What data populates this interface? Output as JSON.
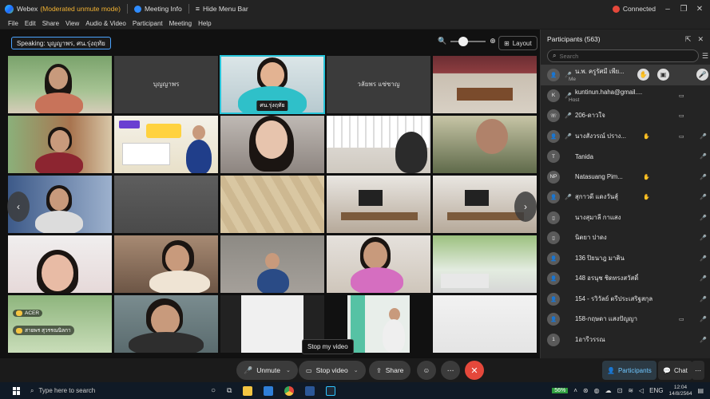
{
  "titlebar": {
    "app_name": "Webex",
    "mode": "(Moderated unmute mode)",
    "meeting_info": "Meeting Info",
    "hide_menu": "Hide Menu Bar",
    "connection": "Connected"
  },
  "menu": [
    "File",
    "Edit",
    "Share",
    "View",
    "Audio & Video",
    "Participant",
    "Meeting",
    "Help"
  ],
  "stage": {
    "speaking": "Speaking: บุญญาพร, ศน.รุ่งฤทัย",
    "layout_label": "Layout",
    "zoom_level": 0.35,
    "tiles": [
      {
        "name": ""
      },
      {
        "name": "บุญญาพร"
      },
      {
        "name": "ศน.รุ่งฤทัย"
      },
      {
        "name": "วลัยพร แซ่ซาญ"
      },
      {
        "name": ""
      },
      {
        "name": ""
      },
      {
        "name": ""
      },
      {
        "name": ""
      },
      {
        "name": ""
      },
      {
        "name": ""
      },
      {
        "name": ""
      },
      {
        "name": ""
      },
      {
        "name": ""
      },
      {
        "name": ""
      },
      {
        "name": ""
      },
      {
        "name": ""
      },
      {
        "name": ""
      },
      {
        "name": ""
      },
      {
        "name": ""
      },
      {
        "name": ""
      },
      {
        "name": ""
      },
      {
        "name": ""
      },
      {
        "name": ""
      },
      {
        "name": ""
      },
      {
        "name": ""
      }
    ],
    "overlay_labels": [
      "ACER",
      "สายพร สุวรรณนิลกา"
    ],
    "tooltip": "Stop my video"
  },
  "controls": {
    "unmute": "Unmute",
    "stop_video": "Stop video",
    "share": "Share",
    "participants_tab": "Participants",
    "chat_tab": "Chat"
  },
  "panel": {
    "title": "Participants (563)",
    "search_placeholder": "Search",
    "rows": [
      {
        "initials": "",
        "name": "น.พ. ครูรัศมี เพีย...",
        "sub": "Me"
      },
      {
        "initials": "K",
        "name": "kuntinun.haha@gmail....",
        "sub": "Host"
      },
      {
        "initials": "",
        "name": "206-ดาวใจ",
        "sub": ""
      },
      {
        "initials": "",
        "name": "นางสังวรณ์ ปราง...",
        "sub": ""
      },
      {
        "initials": "T",
        "name": "Tanida",
        "sub": ""
      },
      {
        "initials": "NP",
        "name": "Natasuang Pim...",
        "sub": ""
      },
      {
        "initials": "",
        "name": "สุกาวดี แดงวันสุ์",
        "sub": ""
      },
      {
        "initials": "",
        "name": "นางสุมาลี กาแสง",
        "sub": ""
      },
      {
        "initials": "",
        "name": "นิตยา ปาดง",
        "sub": ""
      },
      {
        "initials": "",
        "name": "136 ปิยนาฎ มาคิน",
        "sub": ""
      },
      {
        "initials": "",
        "name": "148 อรนุช ชิดทรงสวัสดิ์",
        "sub": ""
      },
      {
        "initials": "",
        "name": "154 - รวิวัลย์ ตรีประเสริฐสกุล",
        "sub": ""
      },
      {
        "initials": "",
        "name": "158-กฤษดา แสงปัญญา",
        "sub": ""
      },
      {
        "initials": "1",
        "name": "1อารีวรรณ",
        "sub": ""
      }
    ]
  },
  "taskbar": {
    "search_placeholder": "Type here to search",
    "battery": "56%",
    "lang": "ENG",
    "time": "12:04",
    "date": "14/8/2564"
  }
}
